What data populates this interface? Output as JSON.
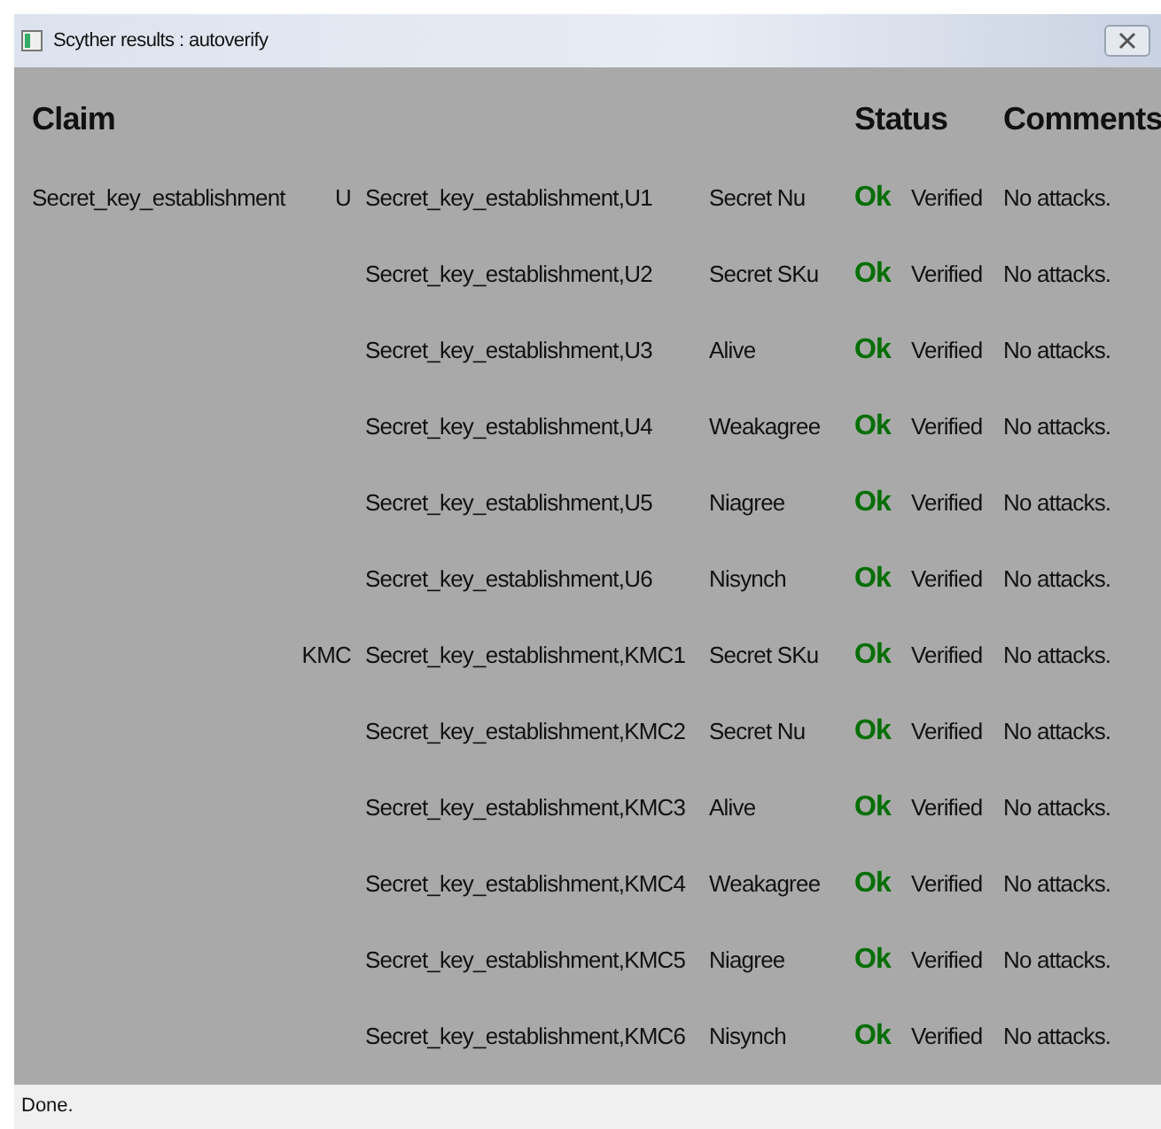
{
  "window": {
    "title": "Scyther results : autoverify"
  },
  "columns": [
    "Claim",
    "Status",
    "Comments"
  ],
  "rows": [
    {
      "claim": "Secret_key_establishment",
      "role": "U",
      "label": "Secret_key_establishment,U1",
      "description": "Secret Nu",
      "status": "Ok",
      "verdict": "Verified",
      "comment": "No attacks."
    },
    {
      "label": "Secret_key_establishment,U2",
      "description": "Secret SKu",
      "status": "Ok",
      "verdict": "Verified",
      "comment": "No attacks."
    },
    {
      "label": "Secret_key_establishment,U3",
      "description": "Alive",
      "status": "Ok",
      "verdict": "Verified",
      "comment": "No attacks."
    },
    {
      "label": "Secret_key_establishment,U4",
      "description": "Weakagree",
      "status": "Ok",
      "verdict": "Verified",
      "comment": "No attacks."
    },
    {
      "label": "Secret_key_establishment,U5",
      "description": "Niagree",
      "status": "Ok",
      "verdict": "Verified",
      "comment": "No attacks."
    },
    {
      "label": "Secret_key_establishment,U6",
      "description": "Nisynch",
      "status": "Ok",
      "verdict": "Verified",
      "comment": "No attacks."
    },
    {
      "role": "KMC",
      "label": "Secret_key_establishment,KMC1",
      "description": "Secret SKu",
      "status": "Ok",
      "verdict": "Verified",
      "comment": "No attacks."
    },
    {
      "label": "Secret_key_establishment,KMC2",
      "description": "Secret Nu",
      "status": "Ok",
      "verdict": "Verified",
      "comment": "No attacks."
    },
    {
      "label": "Secret_key_establishment,KMC3",
      "description": "Alive",
      "status": "Ok",
      "verdict": "Verified",
      "comment": "No attacks."
    },
    {
      "label": "Secret_key_establishment,KMC4",
      "description": "Weakagree",
      "status": "Ok",
      "verdict": "Verified",
      "comment": "No attacks."
    },
    {
      "label": "Secret_key_establishment,KMC5",
      "description": "Niagree",
      "status": "Ok",
      "verdict": "Verified",
      "comment": "No attacks."
    },
    {
      "label": "Secret_key_establishment,KMC6",
      "description": "Nisynch",
      "status": "Ok",
      "verdict": "Verified",
      "comment": "No attacks."
    }
  ],
  "status_bar": "Done."
}
